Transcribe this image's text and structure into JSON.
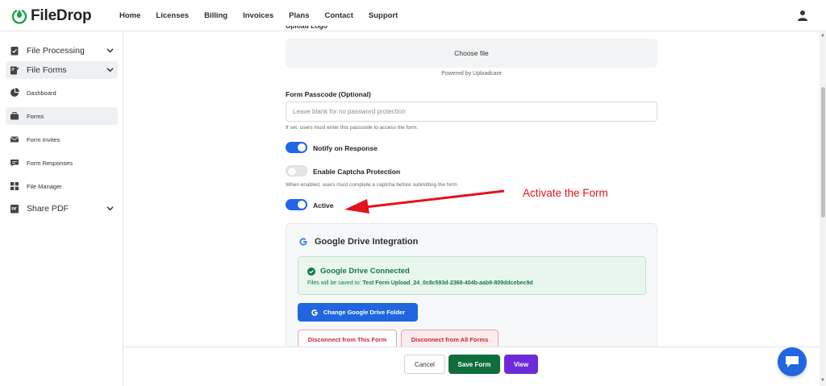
{
  "brand": {
    "name": "FileDrop",
    "color": "#1aa34a"
  },
  "nav": [
    "Home",
    "Licenses",
    "Billing",
    "Invoices",
    "Plans",
    "Contact",
    "Support"
  ],
  "sidebar": {
    "items": [
      {
        "label": "File Processing",
        "icon": "file-check-icon",
        "expandable": true
      },
      {
        "label": "File Forms",
        "icon": "file-form-icon",
        "expandable": true,
        "active": true
      },
      {
        "label": "Dashboard",
        "icon": "pie-chart-icon"
      },
      {
        "label": "Forms",
        "icon": "briefcase-icon",
        "active": true
      },
      {
        "label": "Form Invites",
        "icon": "envelope-icon"
      },
      {
        "label": "Form Responses",
        "icon": "chat-icon"
      },
      {
        "label": "File Manager",
        "icon": "grid-icon"
      },
      {
        "label": "Share PDF",
        "icon": "pdf-icon",
        "expandable": true
      }
    ]
  },
  "form": {
    "upload_logo_label": "Upload Logo",
    "choose_file": "Choose file",
    "powered_by": "Powered by Uploadcare",
    "passcode_label": "Form Passcode (Optional)",
    "passcode_placeholder": "Leave blank for no password protection",
    "passcode_help": "If set, users must enter this passcode to access the form.",
    "notify_label": "Notify on Response",
    "notify_on": true,
    "captcha_label": "Enable Captcha Protection",
    "captcha_on": false,
    "captcha_help": "When enabled, users must complete a captcha before submitting the form",
    "active_label": "Active",
    "active_on": true
  },
  "annotation": {
    "text": "Activate the Form",
    "color": "#e0141c"
  },
  "google_drive": {
    "title": "Google Drive Integration",
    "status": "Google Drive Connected",
    "saved_prefix": "Files will be saved to:",
    "folder": "Test Form Upload_24_0c8c593d-2368-404b-aab9-809ddcebec9d",
    "change_button": "Change Google Drive Folder",
    "disconnect_this": "Disconnect from This Form",
    "disconnect_all": "Disconnect from All Forms"
  },
  "footer": {
    "cancel": "Cancel",
    "save": "Save Form",
    "view": "View"
  },
  "colors": {
    "primary": "#1f66e0",
    "success": "#0f6e3e",
    "purple": "#6c2bd9",
    "danger": "#c62832"
  }
}
